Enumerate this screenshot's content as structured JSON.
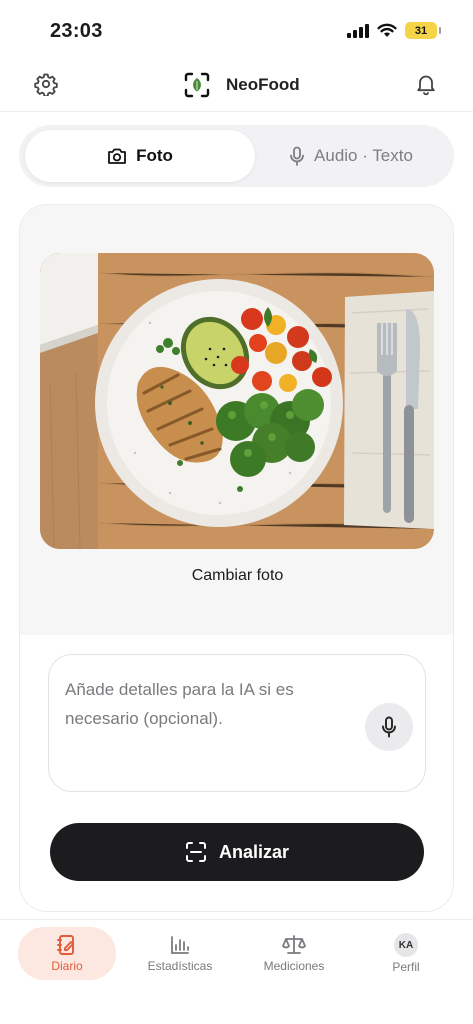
{
  "status_bar": {
    "time": "23:03",
    "battery": "31"
  },
  "header": {
    "settings_icon": "gear-icon",
    "app_title": "NeoFood",
    "notification_icon": "bell-icon"
  },
  "mode_toggle": {
    "photo_label": "Foto",
    "audio_text_label": "Audio · Texto",
    "active": "Foto"
  },
  "photo_card": {
    "change_photo_label": "Cambiar foto",
    "details_placeholder": "Añade detalles para la IA si es necesario (opcional).",
    "analyze_label": "Analizar"
  },
  "tab_bar": {
    "items": [
      {
        "label": "Diario",
        "icon": "journal-icon",
        "active": true
      },
      {
        "label": "Estadísticas",
        "icon": "bar-chart-icon",
        "active": false
      },
      {
        "label": "Mediciones",
        "icon": "scale-icon",
        "active": false
      },
      {
        "label": "Perfil",
        "icon": "avatar",
        "initials": "KA",
        "active": false
      }
    ]
  },
  "colors": {
    "accent": "#e05c3b",
    "accent_bg": "#fde8e1",
    "primary_button": "#1c1c1e",
    "battery": "#f5d547"
  }
}
